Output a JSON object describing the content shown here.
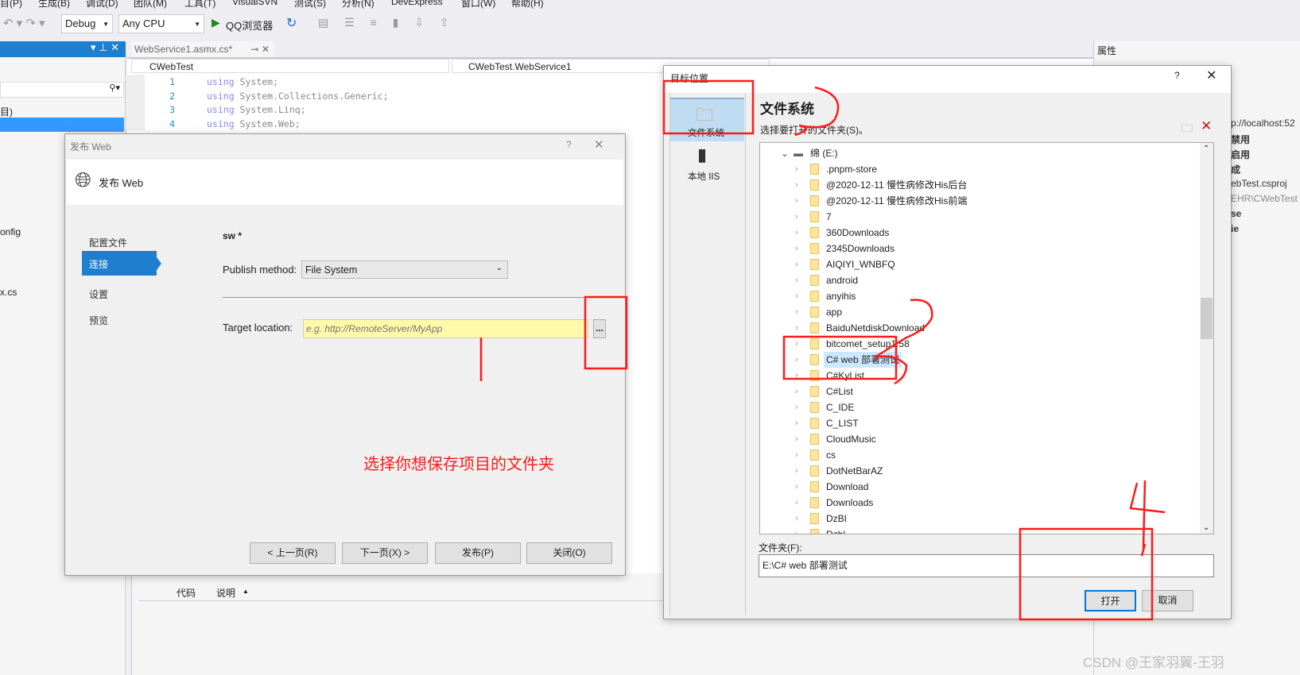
{
  "menu": [
    "目(P)",
    "生成(B)",
    "调试(D)",
    "团队(M)",
    "工具(T)",
    "VisualSVN",
    "测试(S)",
    "分析(N)",
    "DevExpress",
    "窗口(W)",
    "帮助(H)"
  ],
  "toolbar": {
    "config": "Debug",
    "platform": "Any CPU",
    "run_target": "QQ浏览器"
  },
  "editor": {
    "tab": "WebService1.asmx.cs*",
    "project_dropdown": "CWebTest",
    "class_dropdown": "CWebTest.WebService1",
    "lines": [
      {
        "n": "1",
        "kw": "using",
        "rest": " System;"
      },
      {
        "n": "2",
        "kw": "using",
        "rest": " System.Collections.Generic;"
      },
      {
        "n": "3",
        "kw": "using",
        "rest": " System.Linq;"
      },
      {
        "n": "4",
        "kw": "using",
        "rest": " System.Web;"
      }
    ]
  },
  "left_panel": {
    "item1": "目)",
    "item2": "onfig",
    "item3": "x.cs"
  },
  "properties": {
    "title": "属性",
    "rows": [
      "p://localhost:52",
      "禁用",
      "启用",
      "成",
      "ebTest.csproj",
      "EHR\\CWebTest",
      "se",
      "ie"
    ]
  },
  "error_list": {
    "col_code": "代码",
    "col_desc": "说明"
  },
  "publish": {
    "window_title": "发布 Web",
    "header": "发布 Web",
    "nav": [
      "配置文件",
      "连接",
      "设置",
      "预览"
    ],
    "selected_nav": "连接",
    "profile": "sw *",
    "method_label": "Publish method:",
    "method_value": "File System",
    "target_label": "Target location:",
    "target_placeholder": "e.g. http://RemoteServer/MyApp",
    "browse": "...",
    "buttons": [
      "< 上一页(R)",
      "下一页(X) >",
      "发布(P)",
      "关闭(O)"
    ]
  },
  "annotation_text": "选择你想保存项目的文件夹",
  "folder_dialog": {
    "title": "目标位置",
    "sidebar": [
      "文件系统",
      "本地 IIS"
    ],
    "heading": "文件系统",
    "subtitle": "选择要打开的文件夹(S)。",
    "drive": "绵 (E:)",
    "items": [
      ".pnpm-store",
      "@2020-12-11 慢性病修改His后台",
      "@2020-12-11 慢性病修改His前端",
      "7",
      "360Downloads",
      "2345Downloads",
      "AIQIYI_WNBFQ",
      "android",
      "anyihis",
      "app",
      "BaiduNetdiskDownload",
      "bitcomet_setup1.58",
      "C# web 部署测试",
      "C#KyList",
      "C#List",
      "C_IDE",
      "C_LIST",
      "CloudMusic",
      "cs",
      "DotNetBarAZ",
      "Download",
      "Downloads",
      "DzBI",
      "Dzbl..."
    ],
    "selected": "C# web 部署测试",
    "folder_label": "文件夹(F):",
    "folder_value": "E:\\C# web 部署测试",
    "open": "打开",
    "cancel": "取消"
  },
  "watermark": "CSDN @王家羽翼-王羽",
  "colors": {
    "accent": "#1e7fd0",
    "annotation": "#ff1a1a",
    "selection": "#cce8ff"
  }
}
